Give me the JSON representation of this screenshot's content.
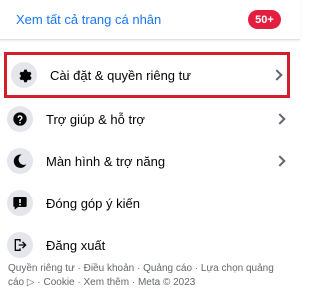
{
  "profile": {
    "see_all_label": "Xem tất cả trang cá nhân",
    "badge": "50+"
  },
  "menu": {
    "items": [
      {
        "label": "Cài đặt & quyền riêng tư",
        "icon": "gear-icon",
        "has_chevron": true
      },
      {
        "label": "Trợ giúp & hỗ trợ",
        "icon": "help-icon",
        "has_chevron": true
      },
      {
        "label": "Màn hình & trợ năng",
        "icon": "moon-icon",
        "has_chevron": true
      },
      {
        "label": "Đóng góp ý kiến",
        "icon": "feedback-icon",
        "has_chevron": false
      },
      {
        "label": "Đăng xuất",
        "icon": "logout-icon",
        "has_chevron": false
      }
    ]
  },
  "footer": {
    "line1": "Quyền riêng tư · Điều khoản · Quảng cáo · Lựa chọn quảng",
    "line2": "cáo ▷ · Cookie · Xem thêm · Meta © 2023"
  },
  "colors": {
    "accent": "#1877f2",
    "badge": "#e41e3f",
    "highlight_border": "#d21f2e",
    "icon_bg": "#e4e6eb"
  }
}
